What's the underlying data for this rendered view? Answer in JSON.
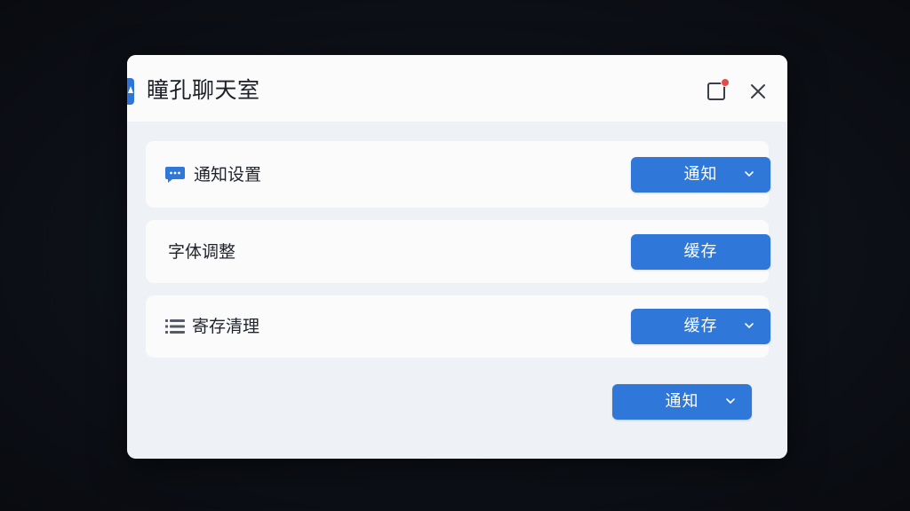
{
  "window": {
    "title": "瞳孔聊天室",
    "icon": "app-logo-icon",
    "restore_icon": "restore-window-icon",
    "notification_dot_color": "#e84a4a",
    "close_icon": "close-icon"
  },
  "rows": [
    {
      "label": "通知设置",
      "icon": "chat-bubble-icon",
      "button_label": "通知",
      "button_icon": "chevron-down-icon"
    },
    {
      "label": "字体调整",
      "button_label": "缓存"
    },
    {
      "label": "寄存清理",
      "icon": "list-icon",
      "button_label": "缓存",
      "button_icon": "chevron-down-icon"
    }
  ],
  "footer": {
    "button_label": "通知",
    "button_icon": "chevron-down-icon"
  },
  "colors": {
    "accent": "#2f78d9",
    "dialog_bg": "#eef1f5",
    "card_bg": "#fbfbfc",
    "backdrop": "#0c0f16"
  }
}
